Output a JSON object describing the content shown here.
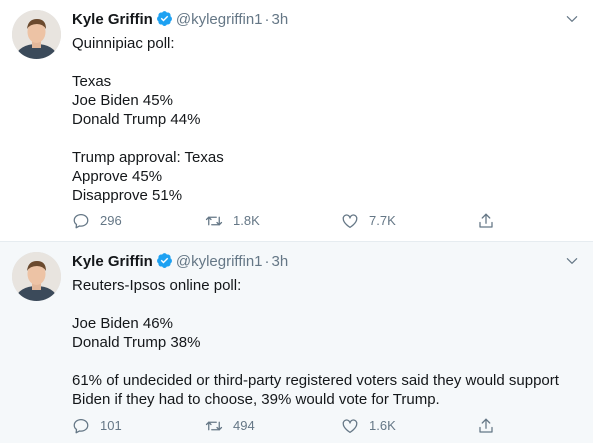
{
  "tweets": [
    {
      "author": {
        "name": "Kyle Griffin",
        "handle": "@kylegriffin1",
        "time": "3h"
      },
      "lines": [
        "Quinnipiac poll:",
        "",
        "Texas",
        "Joe Biden 45%",
        "Donald Trump 44%",
        "",
        "Trump approval: Texas",
        "Approve 45%",
        "Disapprove 51%"
      ],
      "stats": {
        "replies": "296",
        "retweets": "1.8K",
        "likes": "7.7K"
      }
    },
    {
      "author": {
        "name": "Kyle Griffin",
        "handle": "@kylegriffin1",
        "time": "3h"
      },
      "lines": [
        "Reuters-Ipsos online poll:",
        "",
        "Joe Biden 46%",
        "Donald Trump 38%",
        "",
        "61% of undecided or third-party registered voters said they would support",
        "Biden if they had to choose, 39% would vote for Trump."
      ],
      "stats": {
        "replies": "101",
        "retweets": "494",
        "likes": "1.6K"
      }
    }
  ],
  "colors": {
    "accent": "#1da1f2",
    "muted": "#657786",
    "text": "#14171a",
    "highlight_bg": "#f5f8fa"
  },
  "separator": "·",
  "icons": [
    "verified-badge-icon",
    "chevron-down-icon",
    "reply-icon",
    "retweet-icon",
    "like-icon",
    "share-icon"
  ]
}
